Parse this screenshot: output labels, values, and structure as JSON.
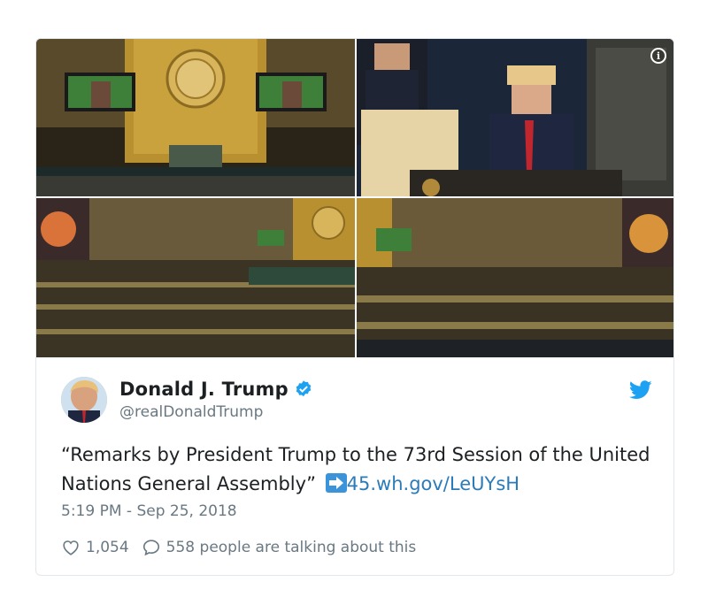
{
  "tweet": {
    "author": {
      "display_name": "Donald J. Trump",
      "handle": "@realDonaldTrump",
      "verified": true
    },
    "text": "“Remarks by President Trump to the 73rd Session of the United Nations General Assembly”",
    "link": "45.wh.gov/LeUYsH",
    "timestamp": "5:19 PM - Sep 25, 2018",
    "likes": "1,054",
    "talking": "558 people are talking about this"
  },
  "photos": [
    {
      "icon": "photo-un-general-assembly-hall"
    },
    {
      "icon": "photo-speaker-at-podium"
    },
    {
      "icon": "photo-assembly-audience-left"
    },
    {
      "icon": "photo-assembly-audience-right"
    }
  ],
  "colors": {
    "link": "#2b7bb9",
    "verified": "#1da1f2",
    "twitter_brand": "#1da1f2",
    "muted_text": "#697882",
    "border": "#e1e8ed"
  },
  "icons": {
    "info": "info-icon",
    "verified": "verified-badge-icon",
    "brand": "twitter-bird-icon",
    "like": "heart-icon",
    "reply": "speech-bubble-icon",
    "link": "arrow-right-icon"
  }
}
